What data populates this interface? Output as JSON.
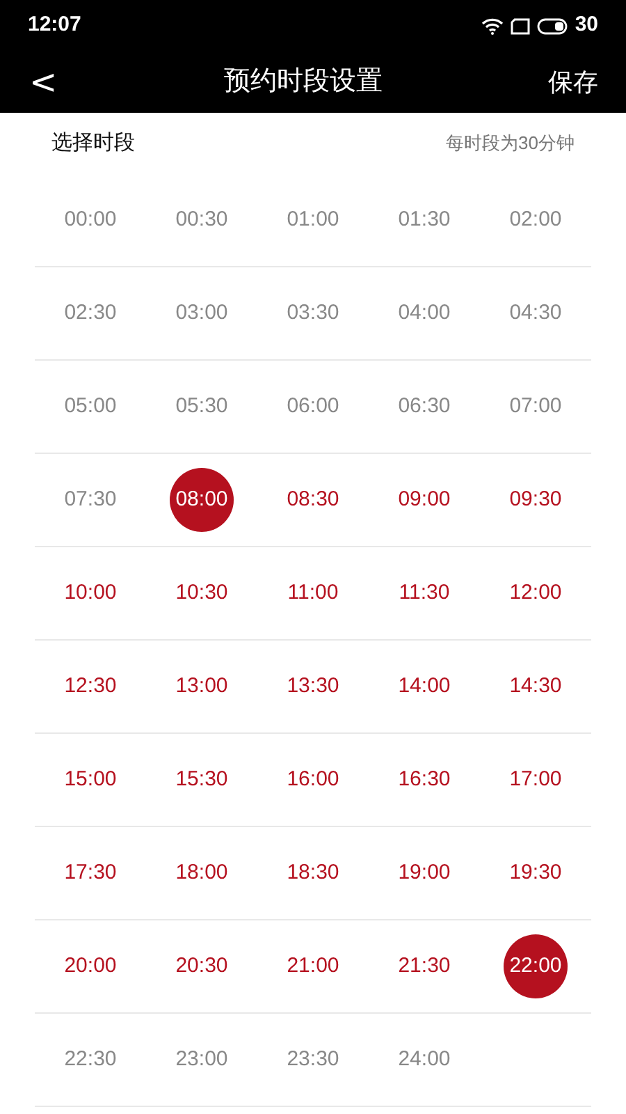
{
  "status_bar": {
    "time": "12:07",
    "battery": "30"
  },
  "header": {
    "back": "<",
    "title": "预约时段设置",
    "save": "保存"
  },
  "section": {
    "title": "选择时段",
    "note": "每时段为30分钟"
  },
  "slots": [
    {
      "label": "00:00",
      "selected": false,
      "in_range": false
    },
    {
      "label": "00:30",
      "selected": false,
      "in_range": false
    },
    {
      "label": "01:00",
      "selected": false,
      "in_range": false
    },
    {
      "label": "01:30",
      "selected": false,
      "in_range": false
    },
    {
      "label": "02:00",
      "selected": false,
      "in_range": false
    },
    {
      "label": "02:30",
      "selected": false,
      "in_range": false
    },
    {
      "label": "03:00",
      "selected": false,
      "in_range": false
    },
    {
      "label": "03:30",
      "selected": false,
      "in_range": false
    },
    {
      "label": "04:00",
      "selected": false,
      "in_range": false
    },
    {
      "label": "04:30",
      "selected": false,
      "in_range": false
    },
    {
      "label": "05:00",
      "selected": false,
      "in_range": false
    },
    {
      "label": "05:30",
      "selected": false,
      "in_range": false
    },
    {
      "label": "06:00",
      "selected": false,
      "in_range": false
    },
    {
      "label": "06:30",
      "selected": false,
      "in_range": false
    },
    {
      "label": "07:00",
      "selected": false,
      "in_range": false
    },
    {
      "label": "07:30",
      "selected": false,
      "in_range": false
    },
    {
      "label": "08:00",
      "selected": true,
      "in_range": true
    },
    {
      "label": "08:30",
      "selected": false,
      "in_range": true
    },
    {
      "label": "09:00",
      "selected": false,
      "in_range": true
    },
    {
      "label": "09:30",
      "selected": false,
      "in_range": true
    },
    {
      "label": "10:00",
      "selected": false,
      "in_range": true
    },
    {
      "label": "10:30",
      "selected": false,
      "in_range": true
    },
    {
      "label": "11:00",
      "selected": false,
      "in_range": true
    },
    {
      "label": "11:30",
      "selected": false,
      "in_range": true
    },
    {
      "label": "12:00",
      "selected": false,
      "in_range": true
    },
    {
      "label": "12:30",
      "selected": false,
      "in_range": true
    },
    {
      "label": "13:00",
      "selected": false,
      "in_range": true
    },
    {
      "label": "13:30",
      "selected": false,
      "in_range": true
    },
    {
      "label": "14:00",
      "selected": false,
      "in_range": true
    },
    {
      "label": "14:30",
      "selected": false,
      "in_range": true
    },
    {
      "label": "15:00",
      "selected": false,
      "in_range": true
    },
    {
      "label": "15:30",
      "selected": false,
      "in_range": true
    },
    {
      "label": "16:00",
      "selected": false,
      "in_range": true
    },
    {
      "label": "16:30",
      "selected": false,
      "in_range": true
    },
    {
      "label": "17:00",
      "selected": false,
      "in_range": true
    },
    {
      "label": "17:30",
      "selected": false,
      "in_range": true
    },
    {
      "label": "18:00",
      "selected": false,
      "in_range": true
    },
    {
      "label": "18:30",
      "selected": false,
      "in_range": true
    },
    {
      "label": "19:00",
      "selected": false,
      "in_range": true
    },
    {
      "label": "19:30",
      "selected": false,
      "in_range": true
    },
    {
      "label": "20:00",
      "selected": false,
      "in_range": true
    },
    {
      "label": "20:30",
      "selected": false,
      "in_range": true
    },
    {
      "label": "21:00",
      "selected": false,
      "in_range": true
    },
    {
      "label": "21:30",
      "selected": false,
      "in_range": true
    },
    {
      "label": "22:00",
      "selected": true,
      "in_range": true
    },
    {
      "label": "22:30",
      "selected": false,
      "in_range": false
    },
    {
      "label": "23:00",
      "selected": false,
      "in_range": false
    },
    {
      "label": "23:30",
      "selected": false,
      "in_range": false
    },
    {
      "label": "24:00",
      "selected": false,
      "in_range": false
    }
  ]
}
